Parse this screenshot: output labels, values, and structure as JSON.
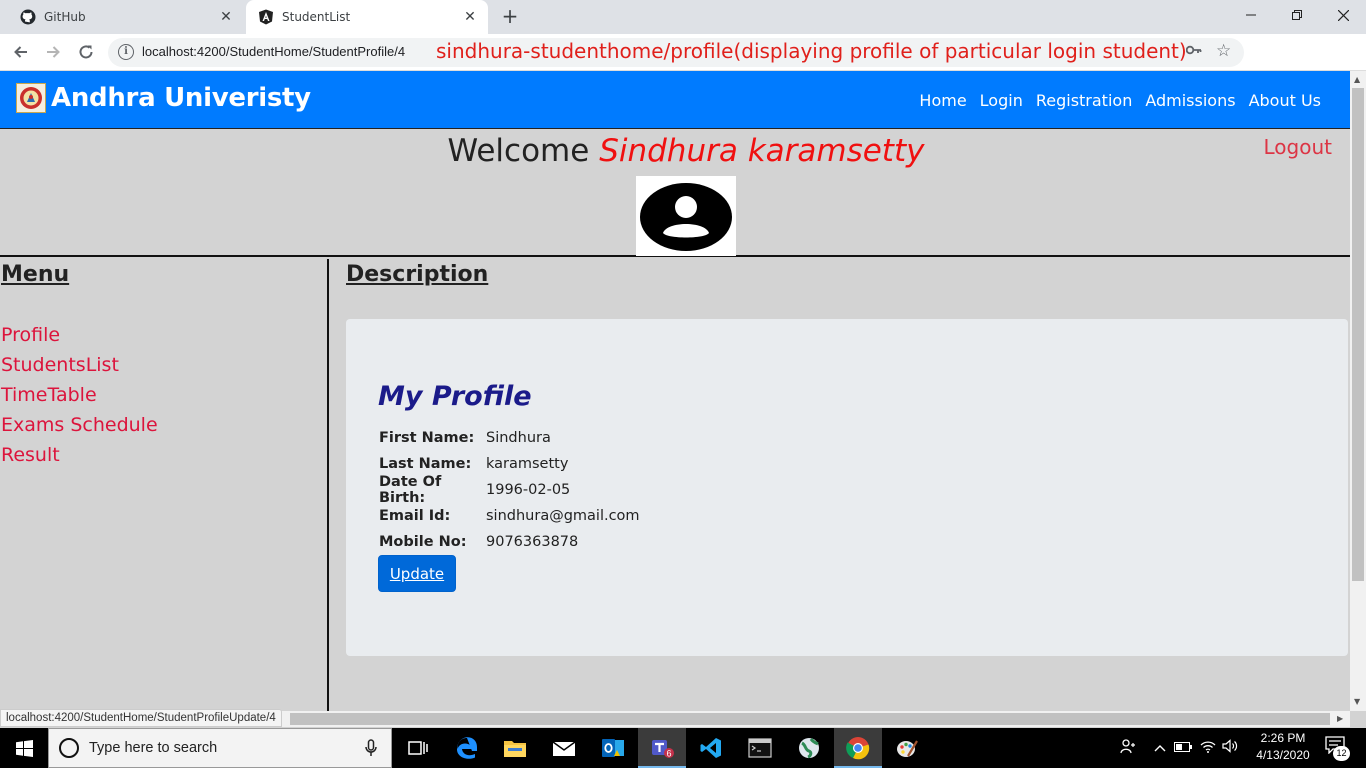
{
  "browser": {
    "tabs": [
      {
        "title": "GitHub"
      },
      {
        "title": "StudentList"
      }
    ],
    "url": "localhost:4200/StudentHome/StudentProfile/4",
    "annotation": "sindhura-studenthome/profile(displaying profile of particular login student)",
    "status_url": "localhost:4200/StudentHome/StudentProfileUpdate/4"
  },
  "navbar": {
    "brand": "Andhra Univeristy",
    "links": [
      "Home",
      "Login",
      "Registration",
      "Admissions",
      "About Us"
    ]
  },
  "welcome": {
    "prefix": "Welcome",
    "name": "Sindhura karamsetty",
    "logout": "Logout"
  },
  "sidebar": {
    "heading": "Menu",
    "items": [
      "Profile",
      "StudentsList",
      "TimeTable",
      "Exams Schedule",
      "Result"
    ]
  },
  "content": {
    "heading": "Description"
  },
  "profile": {
    "title": "My Profile",
    "fields": [
      {
        "label": "First Name:",
        "value": "Sindhura"
      },
      {
        "label": "Last Name:",
        "value": "karamsetty"
      },
      {
        "label": "Date Of Birth:",
        "value": "1996-02-05"
      },
      {
        "label": "Email Id:",
        "value": "sindhura@gmail.com"
      },
      {
        "label": "Mobile No:",
        "value": "9076363878"
      }
    ],
    "update_label": "Update"
  },
  "taskbar": {
    "search_placeholder": "Type here to search",
    "time": "2:26 PM",
    "date": "4/13/2020",
    "notification_count": "12",
    "teams_badge": "6"
  },
  "colors": {
    "navbar": "#007bff",
    "page_bg": "#d3d3d3",
    "card_bg": "#e9ecef",
    "menu_link": "#dc143c",
    "welcome_name": "#f01010",
    "annotation": "#e0201b"
  }
}
